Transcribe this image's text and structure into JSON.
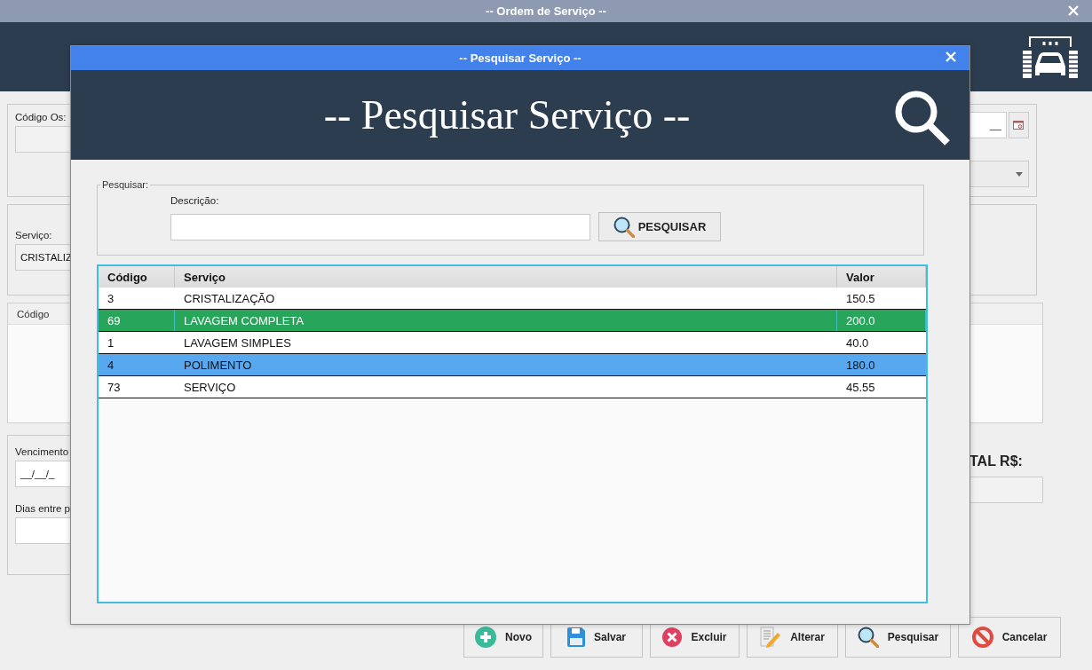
{
  "window": {
    "title": "-- Ordem de Serviço --"
  },
  "form": {
    "codigo_os": {
      "label": "Código Os:"
    },
    "servico": {
      "label": "Serviço:",
      "value": "CRISTALIZ"
    },
    "items_table": {
      "columns": [
        "Código"
      ]
    },
    "vencimento": {
      "label": "Vencimento",
      "value": "__/__/_"
    },
    "dias": {
      "label": "Dias entre p"
    },
    "date": {
      "value": "__"
    },
    "total": {
      "label": "TAL R$:"
    }
  },
  "buttons": [
    {
      "label": "Novo",
      "kind": "plus"
    },
    {
      "label": "Salvar",
      "kind": "save"
    },
    {
      "label": "Excluir",
      "kind": "delete"
    },
    {
      "label": "Alterar",
      "kind": "edit"
    },
    {
      "label": "Pesquisar",
      "kind": "search"
    },
    {
      "label": "Cancelar",
      "kind": "cancel"
    }
  ],
  "dialog": {
    "title": "-- Pesquisar Serviço --",
    "heading": "-- Pesquisar Serviço --",
    "search_group": {
      "legend": "Pesquisar:",
      "field_label": "Descrição:",
      "button": "PESQUISAR"
    },
    "table": {
      "columns": [
        "Código",
        "Serviço",
        "Valor"
      ],
      "rows": [
        {
          "cells": [
            "3",
            "CRISTALIZAÇÃO",
            "150.5"
          ],
          "selected": false,
          "highlighted": false
        },
        {
          "cells": [
            "69",
            "LAVAGEM COMPLETA",
            "200.0"
          ],
          "selected": true,
          "highlighted": false
        },
        {
          "cells": [
            "1",
            "LAVAGEM SIMPLES",
            "40.0"
          ],
          "selected": false,
          "highlighted": false
        },
        {
          "cells": [
            "4",
            "POLIMENTO",
            "180.0"
          ],
          "selected": false,
          "highlighted": true
        },
        {
          "cells": [
            "73",
            "SERVIÇO",
            "45.55"
          ],
          "selected": false,
          "highlighted": false
        }
      ]
    }
  }
}
